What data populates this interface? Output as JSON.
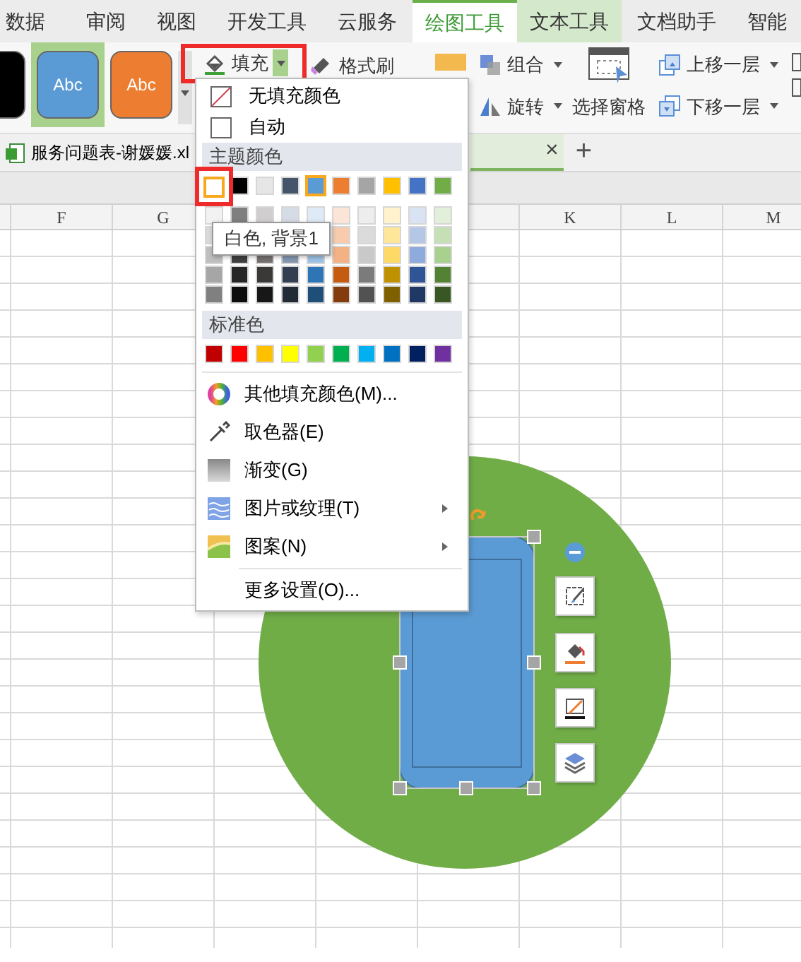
{
  "ribbon_tabs": [
    {
      "label": "数据",
      "selected": false,
      "kind": "plain"
    },
    {
      "label": "审阅",
      "selected": false,
      "kind": "plain"
    },
    {
      "label": "视图",
      "selected": false,
      "kind": "plain"
    },
    {
      "label": "开发工具",
      "selected": false,
      "kind": "plain"
    },
    {
      "label": "云服务",
      "selected": false,
      "kind": "plain"
    },
    {
      "label": "绘图工具",
      "selected": true,
      "kind": "context"
    },
    {
      "label": "文本工具",
      "selected": false,
      "kind": "context"
    },
    {
      "label": "文档助手",
      "selected": false,
      "kind": "plain"
    },
    {
      "label": "智能",
      "selected": false,
      "kind": "plain"
    }
  ],
  "ribbon": {
    "style_presets": [
      {
        "color": "#000000",
        "selected": false
      },
      {
        "label": "Abc",
        "color": "#5b9bd5",
        "selected": true
      },
      {
        "label": "Abc",
        "color": "#ed7d31",
        "selected": false
      }
    ],
    "fill_button": {
      "label": "填充",
      "highlighted": true
    },
    "format_painter": {
      "label": "格式刷"
    },
    "commands": [
      {
        "label": "组合",
        "dropdown": true,
        "kind": "small"
      },
      {
        "label": "旋转",
        "dropdown": true,
        "kind": "small"
      },
      {
        "label": "选择窗格",
        "dropdown": false,
        "kind": "large"
      },
      {
        "label": "上移一层",
        "dropdown": true,
        "kind": "small"
      },
      {
        "label": "下移一层",
        "dropdown": true,
        "kind": "small"
      }
    ]
  },
  "document_tabs": [
    {
      "label": "服务问题表-谢媛媛.xl",
      "selected": false
    },
    {
      "selected": true
    }
  ],
  "tab_close": "×",
  "tab_add": "+",
  "columns": [
    "F",
    "G",
    "K",
    "L",
    "M"
  ],
  "shape": {
    "selected": true
  },
  "fill_menu": {
    "top_items": [
      {
        "label": "无填充颜色",
        "kind": "none"
      },
      {
        "label": "自动",
        "kind": "auto"
      }
    ],
    "theme_header": "主题颜色",
    "theme_colors": [
      {
        "color": "#ffffff",
        "selected": true,
        "highlighted": true
      },
      {
        "color": "#000000",
        "selected": false,
        "highlighted": false
      },
      {
        "color": "#e7e6e6",
        "selected": false,
        "highlighted": false
      },
      {
        "color": "#44546a",
        "selected": false,
        "highlighted": false
      },
      {
        "color": "#5b9bd5",
        "selected": true,
        "highlighted": false
      },
      {
        "color": "#ed7d31",
        "selected": false,
        "highlighted": false
      },
      {
        "color": "#a5a5a5",
        "selected": false,
        "highlighted": false
      },
      {
        "color": "#ffc000",
        "selected": false,
        "highlighted": false
      },
      {
        "color": "#4472c4",
        "selected": false,
        "highlighted": false
      },
      {
        "color": "#70ad47",
        "selected": false,
        "highlighted": false
      }
    ],
    "theme_shades": [
      {
        "swatches": [
          {
            "color": "#f2f2f2"
          },
          {
            "color": "#7f7f7f"
          },
          {
            "color": "#d0cece"
          },
          {
            "color": "#d6dce5"
          },
          {
            "color": "#deebf7"
          },
          {
            "color": "#fbe5d6"
          },
          {
            "color": "#ededed"
          },
          {
            "color": "#fff2cc"
          },
          {
            "color": "#dae3f3"
          },
          {
            "color": "#e2f0d9"
          }
        ]
      },
      {
        "swatches": [
          {
            "color": "#d9d9d9"
          },
          {
            "color": "#f8cbad"
          },
          {
            "color": "#dbdbdb"
          },
          {
            "color": "#ffe699"
          },
          {
            "color": "#b4c7e7"
          },
          {
            "color": "#c5e0b4"
          }
        ]
      },
      {
        "swatches": [
          {
            "color": "#bfbfbf"
          },
          {
            "color": "#404040"
          },
          {
            "color": "#767171"
          },
          {
            "color": "#8497b0"
          },
          {
            "color": "#9dc3e6"
          },
          {
            "color": "#f4b183"
          },
          {
            "color": "#c9c9c9"
          },
          {
            "color": "#ffd966"
          },
          {
            "color": "#8faadc"
          },
          {
            "color": "#a9d18e"
          }
        ]
      },
      {
        "swatches": [
          {
            "color": "#a6a6a6"
          },
          {
            "color": "#262626"
          },
          {
            "color": "#3b3838"
          },
          {
            "color": "#333f50"
          },
          {
            "color": "#2e75b6"
          },
          {
            "color": "#c55a11"
          },
          {
            "color": "#7b7b7b"
          },
          {
            "color": "#bf9000"
          },
          {
            "color": "#2f5597"
          },
          {
            "color": "#548235"
          }
        ]
      },
      {
        "swatches": [
          {
            "color": "#808080"
          },
          {
            "color": "#0d0d0d"
          },
          {
            "color": "#181717"
          },
          {
            "color": "#222a35"
          },
          {
            "color": "#1f4e79"
          },
          {
            "color": "#843c0c"
          },
          {
            "color": "#525252"
          },
          {
            "color": "#7f6000"
          },
          {
            "color": "#203864"
          },
          {
            "color": "#385723"
          }
        ]
      }
    ],
    "tooltip": "白色, 背景1",
    "standard_header": "标准色",
    "standard_colors": [
      {
        "color": "#c00000"
      },
      {
        "color": "#ff0000"
      },
      {
        "color": "#ffc000"
      },
      {
        "color": "#ffff00"
      },
      {
        "color": "#92d050"
      },
      {
        "color": "#00b050"
      },
      {
        "color": "#00b0f0"
      },
      {
        "color": "#0070c0"
      },
      {
        "color": "#002060"
      },
      {
        "color": "#7030a0"
      }
    ],
    "commands": [
      {
        "label": "其他填充颜色(M)...",
        "kind": "palette",
        "submenu": false
      },
      {
        "label": "取色器(E)",
        "kind": "eyedropper",
        "submenu": false
      },
      {
        "label": "渐变(G)",
        "kind": "gradient",
        "submenu": false
      },
      {
        "label": "图片或纹理(T)",
        "kind": "texture",
        "submenu": true
      },
      {
        "label": "图案(N)",
        "kind": "pattern",
        "submenu": true
      },
      {
        "label": "更多设置(O)...",
        "kind": "plain",
        "submenu": false
      }
    ]
  }
}
